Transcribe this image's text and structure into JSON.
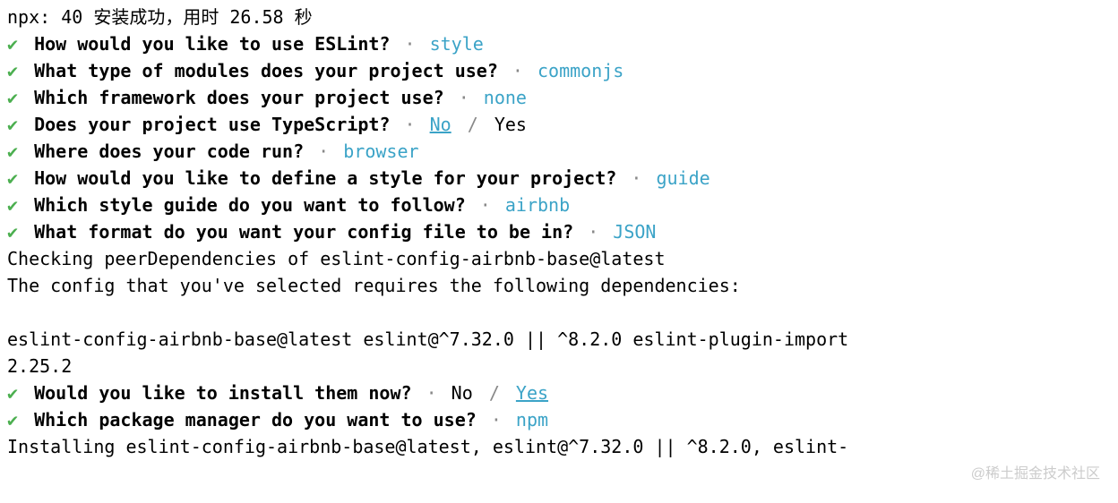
{
  "header": "npx: 40 安装成功，用时 26.58 秒",
  "questions": [
    {
      "q": "How would you like to use ESLint?",
      "ans": "style"
    },
    {
      "q": "What type of modules does your project use?",
      "ans": "commonjs"
    },
    {
      "q": "Which framework does your project use?",
      "ans": "none"
    },
    {
      "q": "Does your project use TypeScript?",
      "selected": "No",
      "other": "Yes",
      "selected_first": true
    },
    {
      "q": "Where does your code run?",
      "ans": "browser"
    },
    {
      "q": "How would you like to define a style for your project?",
      "ans": "guide"
    },
    {
      "q": "Which style guide do you want to follow?",
      "ans": "airbnb"
    },
    {
      "q": "What format do you want your config file to be in?",
      "ans": "JSON"
    }
  ],
  "info1": "Checking peerDependencies of eslint-config-airbnb-base@latest",
  "info2": "The config that you've selected requires the following dependencies:",
  "info3": "eslint-config-airbnb-base@latest eslint@^7.32.0 || ^8.2.0 eslint-plugin-import",
  "info4": "2.25.2",
  "questions2": [
    {
      "q": "Would you like to install them now?",
      "selected": "Yes",
      "other": "No",
      "selected_first": false
    },
    {
      "q": "Which package manager do you want to use?",
      "ans": "npm"
    }
  ],
  "footer": "Installing eslint-config-airbnb-base@latest, eslint@^7.32.0 || ^8.2.0, eslint-",
  "check": "✔",
  "dot": "·",
  "slash": "/",
  "watermark": "@稀土掘金技术社区"
}
